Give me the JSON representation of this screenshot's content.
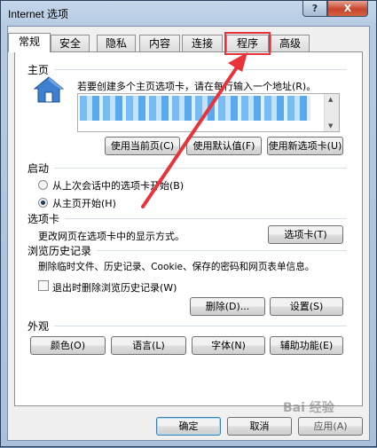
{
  "window": {
    "title": "Internet 选项",
    "help_label": "?",
    "close_label": "X"
  },
  "tabs": [
    {
      "label": "常规",
      "active": true
    },
    {
      "label": "安全"
    },
    {
      "label": "隐私"
    },
    {
      "label": "内容"
    },
    {
      "label": "连接"
    },
    {
      "label": "程序"
    },
    {
      "label": "高级"
    }
  ],
  "homepage": {
    "section": "主页",
    "desc": "若要创建多个主页选项卡，请在每行输入一个地址(R)。",
    "use_current": "使用当前页(C)",
    "use_default": "使用默认值(F)",
    "use_new_tab": "使用新选项卡(U)"
  },
  "startup": {
    "section": "启动",
    "option_last_session": "从上次会话中的选项卡开始(B)",
    "option_home": "从主页开始(H)",
    "selected": "option_home"
  },
  "tabs_section": {
    "section": "选项卡",
    "desc": "更改网页在选项卡中的显示方式。",
    "button": "选项卡(T)"
  },
  "history": {
    "section": "浏览历史记录",
    "desc": "删除临时文件、历史记录、Cookie、保存的密码和网页表单信息。",
    "checkbox": "退出时删除浏览历史记录(W)",
    "delete": "删除(D)...",
    "settings": "设置(S)"
  },
  "appearance": {
    "section": "外观",
    "colors": "颜色(O)",
    "languages": "语言(L)",
    "fonts": "字体(N)",
    "accessibility": "辅助功能(E)"
  },
  "footer": {
    "ok": "确定",
    "cancel": "取消",
    "apply": "应用(A)"
  },
  "watermark": "Bai 经验",
  "colors": {
    "highlight": "#e8333b",
    "title_bg": "#b6cbe3"
  }
}
